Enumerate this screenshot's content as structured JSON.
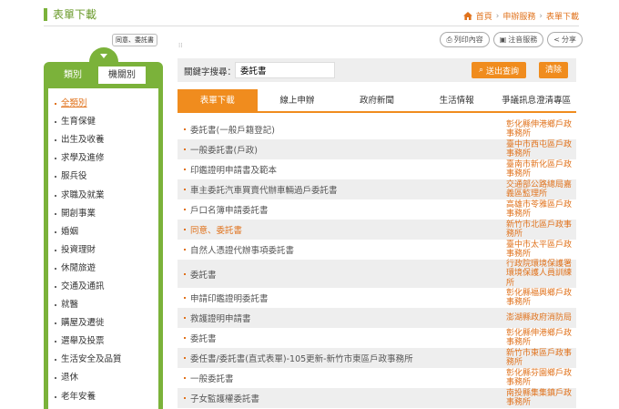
{
  "page": {
    "title": "表單下載"
  },
  "breadcrumb": {
    "home": "首頁",
    "section": "申辦服務",
    "current": "表單下載"
  },
  "tag": "同意、委託書",
  "tools": {
    "print": "列印內容",
    "phonetic": "注音服務",
    "share": "分享"
  },
  "sidebar": {
    "tabs": [
      "類別",
      "機關別"
    ],
    "items": [
      "全類別",
      "生育保健",
      "出生及收養",
      "求學及進修",
      "服兵役",
      "求職及就業",
      "開創事業",
      "婚姻",
      "投資理財",
      "休閒旅遊",
      "交通及通訊",
      "就醫",
      "購屋及遷徙",
      "選舉及投票",
      "生活安全及品質",
      "退休",
      "老年安養"
    ]
  },
  "search": {
    "label": "關鍵字搜尋：",
    "value": "委託書",
    "submit": "送出查詢",
    "clear": "清除"
  },
  "tabs": [
    "表單下載",
    "線上申辦",
    "政府新聞",
    "生活情報",
    "爭議訊息澄清專區"
  ],
  "results": [
    {
      "name": "委託書(一般戶籍登記)",
      "org": "彰化縣伸港鄉戶政事務所"
    },
    {
      "name": "一般委託書(戶政)",
      "org": "臺中市西屯區戶政事務所"
    },
    {
      "name": "印鑑證明申請書及範本",
      "org": "臺南市新化區戶政事務所"
    },
    {
      "name": "車主委託汽車買賣代辦車輛過戶委託書",
      "org": "交通部公路總局嘉義區監理所"
    },
    {
      "name": "戶口名簿申請委託書",
      "org": "高雄市苓雅區戶政事務所"
    },
    {
      "name": "同意、委託書",
      "org": "新竹市北區戶政事務所"
    },
    {
      "name": "自然人憑證代辦事項委託書",
      "org": "臺中市太平區戶政事務所"
    },
    {
      "name": "委託書",
      "org": "行政院環境保護署環境保護人員訓練所"
    },
    {
      "name": "申請印鑑證明委託書",
      "org": "彰化縣福興鄉戶政事務所"
    },
    {
      "name": "救護證明申請書",
      "org": "澎湖縣政府消防局"
    },
    {
      "name": "委託書",
      "org": "彰化縣伸港鄉戶政事務所"
    },
    {
      "name": "委任書/委託書(直式表單)-105更新-新竹市東區戶政事務所",
      "org": "新竹市東區戶政事務所"
    },
    {
      "name": "一般委託書",
      "org": "彰化縣芬園鄉戶政事務所"
    },
    {
      "name": "子女監護權委託書",
      "org": "南投縣集集鎮戶政事務所"
    }
  ]
}
